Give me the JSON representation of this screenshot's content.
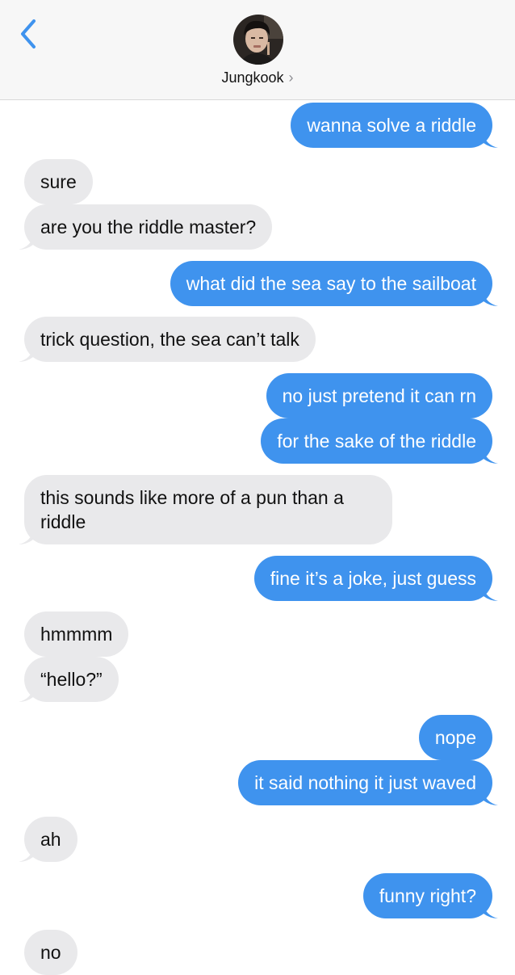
{
  "header": {
    "contact_name": "Jungkook",
    "chevron": "›",
    "back_icon": "back-chevron-icon",
    "accent_color": "#3f93ee"
  },
  "messages": [
    {
      "from": "me",
      "text": "wanna solve a riddle"
    },
    {
      "from": "them",
      "text": "sure"
    },
    {
      "from": "them",
      "text": "are you the riddle master?"
    },
    {
      "from": "me",
      "text": "what did the sea say to the sailboat"
    },
    {
      "from": "them",
      "text": "trick question, the sea can’t talk"
    },
    {
      "from": "me",
      "text": "no just pretend it can rn"
    },
    {
      "from": "me",
      "text": "for the sake of the riddle"
    },
    {
      "from": "them",
      "text": "this sounds like more of a pun than a riddle"
    },
    {
      "from": "me",
      "text": "fine it’s a joke, just guess"
    },
    {
      "from": "them",
      "text": "hmmmm"
    },
    {
      "from": "them",
      "text": "“hello?”"
    },
    {
      "from": "me",
      "text": "nope"
    },
    {
      "from": "me",
      "text": "it said nothing it just waved"
    },
    {
      "from": "them",
      "text": "ah"
    },
    {
      "from": "me",
      "text": "funny right?"
    },
    {
      "from": "them",
      "text": "no"
    }
  ]
}
